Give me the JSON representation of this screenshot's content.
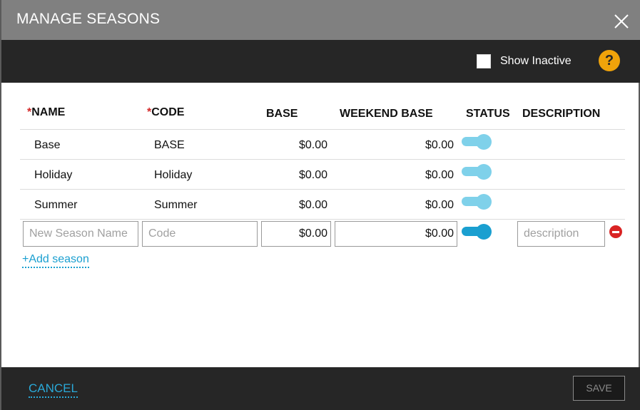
{
  "dialog": {
    "title": "MANAGE SEASONS",
    "close_icon": "close-icon"
  },
  "toolbar": {
    "show_inactive_label": "Show Inactive",
    "show_inactive_checked": false,
    "help_label": "?"
  },
  "columns": {
    "required_marker": "*",
    "name": "NAME",
    "code": "CODE",
    "base": "BASE",
    "weekend_base": "WEEKEND BASE",
    "status": "STATUS",
    "description": "DESCRIPTION"
  },
  "rows": [
    {
      "name": "Base",
      "code": "BASE",
      "base": "$0.00",
      "weekend_base": "$0.00",
      "status": "active"
    },
    {
      "name": "Holiday",
      "code": "Holiday",
      "base": "$0.00",
      "weekend_base": "$0.00",
      "status": "active"
    },
    {
      "name": "Summer",
      "code": "Summer",
      "base": "$0.00",
      "weekend_base": "$0.00",
      "status": "active"
    }
  ],
  "new_row": {
    "name_placeholder": "New Season Name",
    "code_placeholder": "Code",
    "base_value": "$0.00",
    "weekend_base_value": "$0.00",
    "description_placeholder": "description",
    "status": "active"
  },
  "add_season_label": "+Add season",
  "footer": {
    "cancel_label": "CANCEL",
    "save_label": "SAVE"
  },
  "colors": {
    "accent": "#1a9fd0",
    "help": "#f0a30a",
    "remove": "#d92323",
    "toolbar_bg": "#262626",
    "title_bg": "#808080"
  }
}
